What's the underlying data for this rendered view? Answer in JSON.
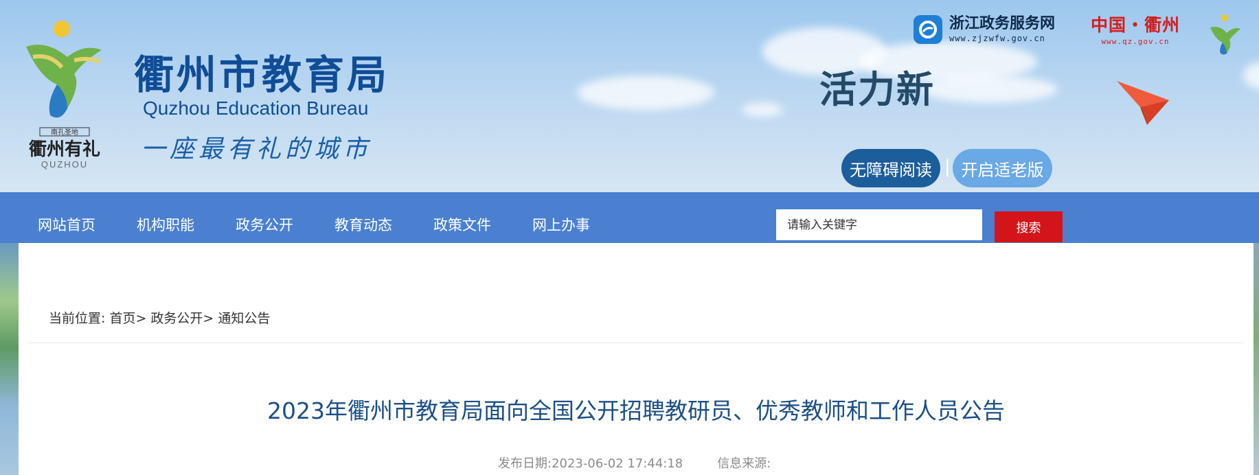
{
  "header": {
    "site_title": "衢州市教育局",
    "site_subtitle": "Quzhou Education Bureau",
    "slogan": "一座最有礼的城市",
    "brand_text": "衢州有礼",
    "brand_small": "南孔圣地",
    "brand_pinyin": "QUZHOU",
    "banner_text": "活力新",
    "zj_link": {
      "name": "浙江政务服务网",
      "url": "www.zjzwfw.gov.cn"
    },
    "qz_link": {
      "name": "中国・衢州",
      "url": "www.qz.gov.cn"
    },
    "accessibility_label": "无障碍阅读",
    "elder_mode_label": "开启适老版",
    "separator": "|"
  },
  "nav": {
    "items": [
      {
        "label": "网站首页"
      },
      {
        "label": "机构职能"
      },
      {
        "label": "政务公开"
      },
      {
        "label": "教育动态"
      },
      {
        "label": "政策文件"
      },
      {
        "label": "网上办事"
      }
    ],
    "search_placeholder": "请输入关键字",
    "search_button": "搜索"
  },
  "breadcrumb": {
    "prefix": "当前位置:",
    "items": [
      "首页>",
      "政务公开>",
      "通知公告"
    ]
  },
  "article": {
    "title": "2023年衢州市教育局面向全国公开招聘教研员、优秀教师和工作人员公告",
    "date_label": "发布日期:",
    "date_value": "2023-06-02 17:44:18",
    "source_label": "信息来源:",
    "source_value": ""
  },
  "colors": {
    "nav_bg": "#4a80cf",
    "search_btn": "#d4141b",
    "title_color": "#1b4f86",
    "accessibility_btn": "#1c5d9c",
    "elder_btn": "#6aa8e6"
  }
}
